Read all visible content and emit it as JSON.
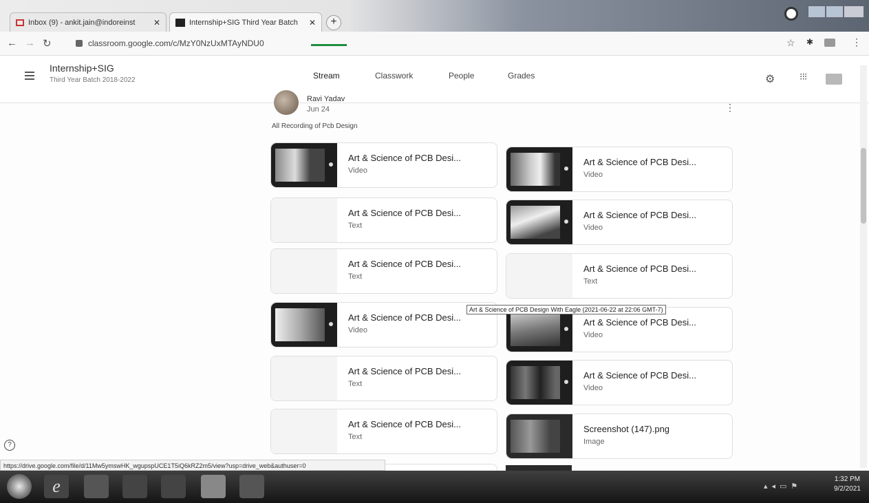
{
  "browser": {
    "tabs": [
      {
        "label": "Inbox (9) - ankit.jain@indoreinst"
      },
      {
        "label": "Internship+SIG Third Year Batch"
      }
    ],
    "url": "classroom.google.com/c/MzY0NzUxMTAyNDU0",
    "status_url": "https://drive.google.com/file/d/11Mw5ymswHK_wgupspUCE1T5iQ6kRZ2m5/view?usp=drive_web&authuser=0"
  },
  "header": {
    "class_title": "Internship+SIG",
    "class_subtitle": "Third Year Batch 2018-2022",
    "tabs": [
      {
        "label": "Stream"
      },
      {
        "label": "Classwork"
      },
      {
        "label": "People"
      },
      {
        "label": "Grades"
      }
    ]
  },
  "post": {
    "author": "Ravi Yadav",
    "date": "Jun 24",
    "description": "All Recording of Pcb Design"
  },
  "attachments": [
    {
      "title": "Art & Science of PCB Desi...",
      "type": "Video"
    },
    {
      "title": "Art & Science of PCB Desi...",
      "type": "Video"
    },
    {
      "title": "Art & Science of PCB Desi...",
      "type": "Text"
    },
    {
      "title": "Art & Science of PCB Desi...",
      "type": "Video"
    },
    {
      "title": "Art & Science of PCB Desi...",
      "type": "Text"
    },
    {
      "title": "Art & Science of PCB Desi...",
      "type": "Text"
    },
    {
      "title": "Art & Science of PCB Desi...",
      "type": "Video"
    },
    {
      "title": "Art & Science of PCB Desi...",
      "type": "Video"
    },
    {
      "title": "Art & Science of PCB Desi...",
      "type": "Text"
    },
    {
      "title": "Art & Science of PCB Desi...",
      "type": "Video"
    },
    {
      "title": "Art & Science of PCB Desi...",
      "type": "Text"
    },
    {
      "title": "Screenshot (147).png",
      "type": "Image"
    }
  ],
  "tooltip": "Art & Science of PCB Design With Eagle (2021-06-22 at 22:06 GMT-7)",
  "taskbar": {
    "time": "1:32 PM",
    "date": "9/2/2021"
  },
  "help_glyph": "?"
}
